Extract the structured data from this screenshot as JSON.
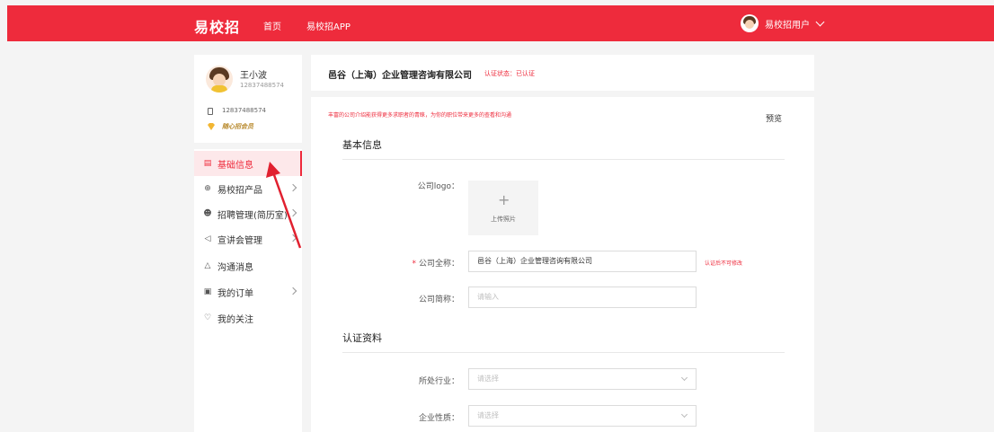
{
  "header": {
    "logo": "易校招",
    "nav_home": "首页",
    "nav_app": "易校招APP",
    "user_name": "易校招用户"
  },
  "profile": {
    "name": "王小波",
    "id": "12837488574",
    "phone": "12837488574",
    "vip_label": "随心招会员"
  },
  "sidebar": {
    "items": [
      {
        "label": "基础信息",
        "icon": "document-icon",
        "active": true,
        "has_arrow": false
      },
      {
        "label": "易校招产品",
        "icon": "box-icon",
        "active": false,
        "has_arrow": true
      },
      {
        "label": "招聘管理(简历室)",
        "icon": "people-icon",
        "active": false,
        "has_arrow": true
      },
      {
        "label": "宣讲会管理",
        "icon": "speaker-icon",
        "active": false,
        "has_arrow": true
      },
      {
        "label": "沟通消息",
        "icon": "bell-icon",
        "active": false,
        "has_arrow": false
      },
      {
        "label": "我的订单",
        "icon": "order-icon",
        "active": false,
        "has_arrow": true
      },
      {
        "label": "我的关注",
        "icon": "heart-icon",
        "active": false,
        "has_arrow": false
      }
    ]
  },
  "company_header": {
    "name": "邑谷（上海）企业管理咨询有限公司",
    "cert_status": "认证状态：已认证"
  },
  "form": {
    "tip": "丰富的公司介绍能获得更多求职者的青睐，为你的职位带来更多的查看和沟通",
    "preview": "预览",
    "basic_section": "基本信息",
    "logo_label": "公司logo：",
    "upload_text": "上传照片",
    "fullname_label": "公司全称：",
    "fullname_value": "邑谷（上海）企业管理咨询有限公司",
    "fullname_note": "认证后不可修改",
    "shortname_label": "公司简称：",
    "shortname_placeholder": "请输入",
    "cert_section": "认证资料",
    "industry_label": "所处行业：",
    "industry_placeholder": "请选择",
    "nature_label": "企业性质：",
    "nature_placeholder": "请选择"
  },
  "colors": {
    "brand": "#ee2b3c",
    "vip": "#b88a2e"
  }
}
